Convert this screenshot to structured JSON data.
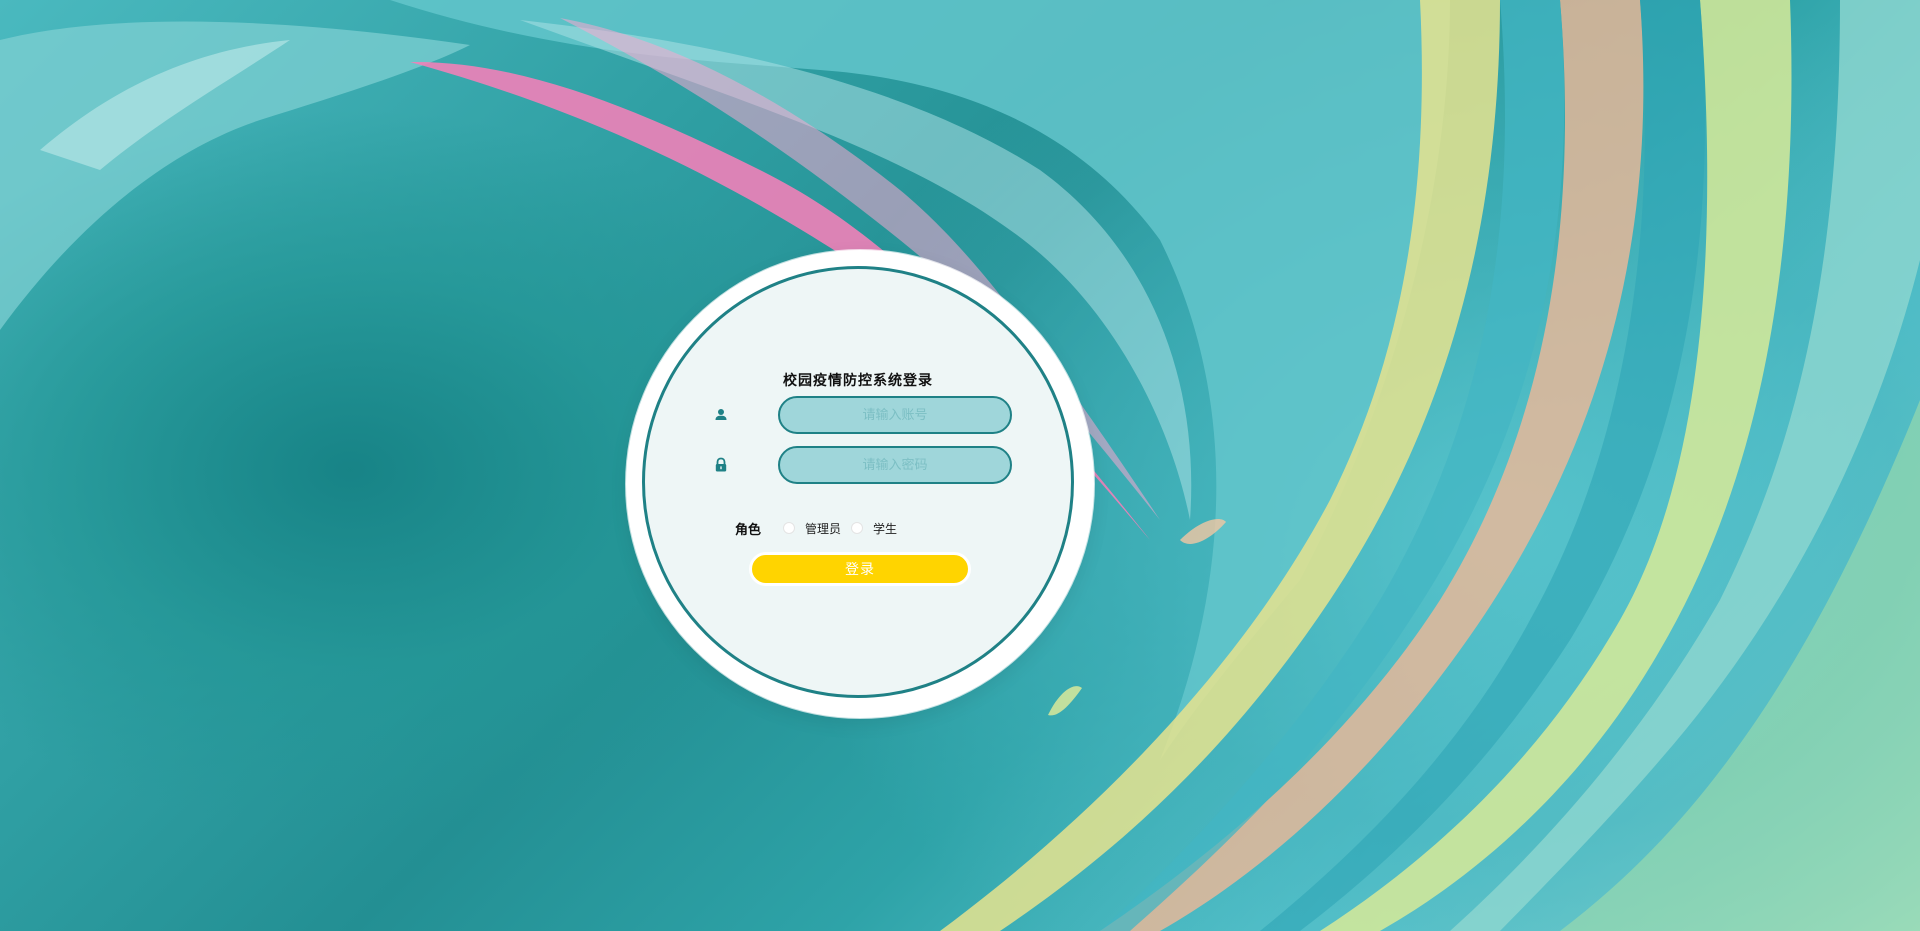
{
  "login": {
    "title": "校园疫情防控系统登录",
    "username_placeholder": "请输入账号",
    "password_placeholder": "请输入密码",
    "role_label": "角色",
    "roles": [
      {
        "label": "管理员"
      },
      {
        "label": "学生"
      }
    ],
    "submit_label": "登录"
  },
  "icons": {
    "username": "user-icon",
    "password": "lock-icon"
  },
  "colors": {
    "accent": "#1f8186",
    "input_fill": "#9fd6da",
    "button": "#ffd400",
    "card": "#eef6f6"
  }
}
